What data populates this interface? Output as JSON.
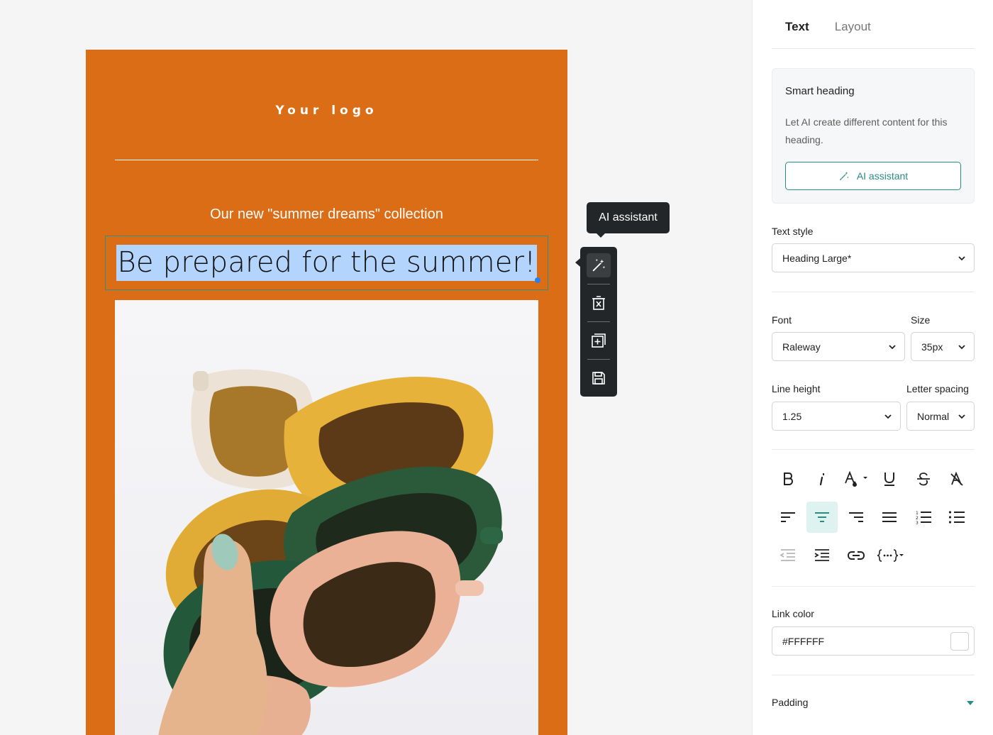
{
  "email": {
    "logo": "Your logo",
    "subheading": "Our new \"summer dreams\" collection",
    "heading": "Be prepared for the summer!",
    "background_color": "#dc6d17",
    "image_alt": "hand holding stacked colorful sunglasses"
  },
  "toolbar": {
    "tooltip": "AI assistant",
    "buttons": [
      "ai-magic-icon",
      "delete-icon",
      "duplicate-icon",
      "save-icon"
    ]
  },
  "panel": {
    "tabs": [
      {
        "label": "Text",
        "active": true
      },
      {
        "label": "Layout",
        "active": false
      }
    ],
    "smart_heading": {
      "title": "Smart heading",
      "description": "Let AI create different content for this heading.",
      "button": "AI assistant"
    },
    "text_style": {
      "label": "Text style",
      "value": "Heading Large*"
    },
    "font": {
      "label": "Font",
      "value": "Raleway"
    },
    "size": {
      "label": "Size",
      "value": "35px"
    },
    "line_height": {
      "label": "Line height",
      "value": "1.25"
    },
    "letter_spacing": {
      "label": "Letter spacing",
      "value": "Normal"
    },
    "formatting": [
      "bold",
      "italic",
      "text-color",
      "underline",
      "strikethrough",
      "clear-format"
    ],
    "alignment": [
      "align-left",
      "align-center",
      "align-right",
      "justify",
      "ordered-list",
      "unordered-list"
    ],
    "active_alignment": "align-center",
    "misc": [
      "outdent",
      "indent",
      "link",
      "merge-tags"
    ],
    "link_color": {
      "label": "Link color",
      "value": "#FFFFFF"
    },
    "padding": {
      "label": "Padding"
    }
  },
  "colors": {
    "accent": "#2a8c82",
    "toolbar": "#232628",
    "selection": "#b3d4fc"
  }
}
